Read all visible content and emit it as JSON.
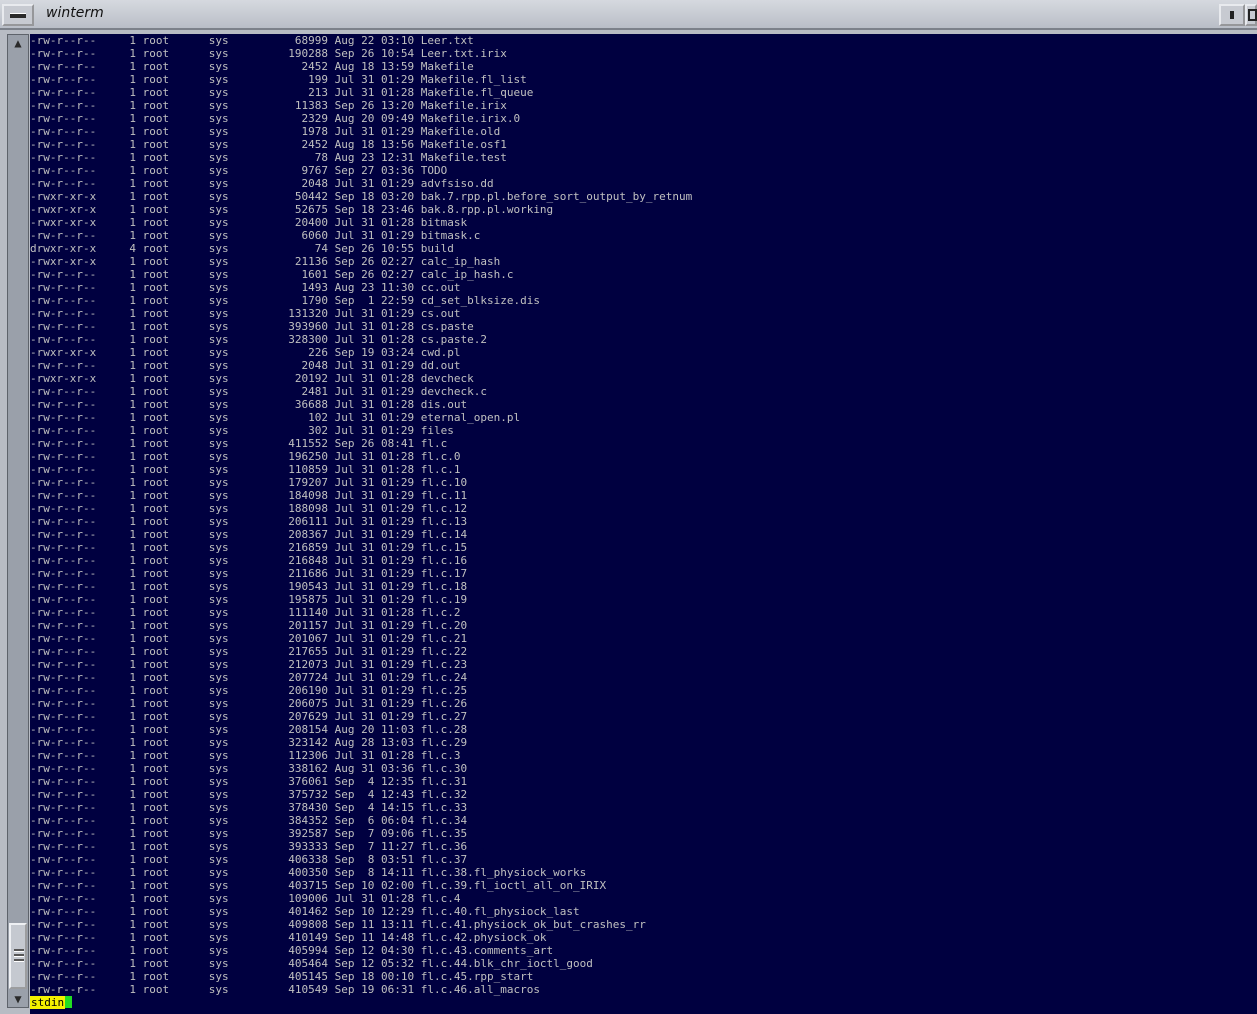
{
  "window": {
    "title": "winterm"
  },
  "prompt": {
    "label": "stdin"
  },
  "listing": [
    {
      "perm": "-rw-r--r--",
      "links": "1",
      "owner": "root",
      "group": "sys",
      "size": "68999",
      "date": "Aug 22 03:10",
      "name": "Leer.txt"
    },
    {
      "perm": "-rw-r--r--",
      "links": "1",
      "owner": "root",
      "group": "sys",
      "size": "190288",
      "date": "Sep 26 10:54",
      "name": "Leer.txt.irix"
    },
    {
      "perm": "-rw-r--r--",
      "links": "1",
      "owner": "root",
      "group": "sys",
      "size": "2452",
      "date": "Aug 18 13:59",
      "name": "Makefile"
    },
    {
      "perm": "-rw-r--r--",
      "links": "1",
      "owner": "root",
      "group": "sys",
      "size": "199",
      "date": "Jul 31 01:29",
      "name": "Makefile.fl_list"
    },
    {
      "perm": "-rw-r--r--",
      "links": "1",
      "owner": "root",
      "group": "sys",
      "size": "213",
      "date": "Jul 31 01:28",
      "name": "Makefile.fl_queue"
    },
    {
      "perm": "-rw-r--r--",
      "links": "1",
      "owner": "root",
      "group": "sys",
      "size": "11383",
      "date": "Sep 26 13:20",
      "name": "Makefile.irix"
    },
    {
      "perm": "-rw-r--r--",
      "links": "1",
      "owner": "root",
      "group": "sys",
      "size": "2329",
      "date": "Aug 20 09:49",
      "name": "Makefile.irix.0"
    },
    {
      "perm": "-rw-r--r--",
      "links": "1",
      "owner": "root",
      "group": "sys",
      "size": "1978",
      "date": "Jul 31 01:29",
      "name": "Makefile.old"
    },
    {
      "perm": "-rw-r--r--",
      "links": "1",
      "owner": "root",
      "group": "sys",
      "size": "2452",
      "date": "Aug 18 13:56",
      "name": "Makefile.osf1"
    },
    {
      "perm": "-rw-r--r--",
      "links": "1",
      "owner": "root",
      "group": "sys",
      "size": "78",
      "date": "Aug 23 12:31",
      "name": "Makefile.test"
    },
    {
      "perm": "-rw-r--r--",
      "links": "1",
      "owner": "root",
      "group": "sys",
      "size": "9767",
      "date": "Sep 27 03:36",
      "name": "TODO"
    },
    {
      "perm": "-rw-r--r--",
      "links": "1",
      "owner": "root",
      "group": "sys",
      "size": "2048",
      "date": "Jul 31 01:29",
      "name": "advfsiso.dd"
    },
    {
      "perm": "-rwxr-xr-x",
      "links": "1",
      "owner": "root",
      "group": "sys",
      "size": "50442",
      "date": "Sep 18 03:20",
      "name": "bak.7.rpp.pl.before_sort_output_by_retnum"
    },
    {
      "perm": "-rwxr-xr-x",
      "links": "1",
      "owner": "root",
      "group": "sys",
      "size": "52675",
      "date": "Sep 18 23:46",
      "name": "bak.8.rpp.pl.working"
    },
    {
      "perm": "-rwxr-xr-x",
      "links": "1",
      "owner": "root",
      "group": "sys",
      "size": "20400",
      "date": "Jul 31 01:28",
      "name": "bitmask"
    },
    {
      "perm": "-rw-r--r--",
      "links": "1",
      "owner": "root",
      "group": "sys",
      "size": "6060",
      "date": "Jul 31 01:29",
      "name": "bitmask.c"
    },
    {
      "perm": "drwxr-xr-x",
      "links": "4",
      "owner": "root",
      "group": "sys",
      "size": "74",
      "date": "Sep 26 10:55",
      "name": "build"
    },
    {
      "perm": "-rwxr-xr-x",
      "links": "1",
      "owner": "root",
      "group": "sys",
      "size": "21136",
      "date": "Sep 26 02:27",
      "name": "calc_ip_hash"
    },
    {
      "perm": "-rw-r--r--",
      "links": "1",
      "owner": "root",
      "group": "sys",
      "size": "1601",
      "date": "Sep 26 02:27",
      "name": "calc_ip_hash.c"
    },
    {
      "perm": "-rw-r--r--",
      "links": "1",
      "owner": "root",
      "group": "sys",
      "size": "1493",
      "date": "Aug 23 11:30",
      "name": "cc.out"
    },
    {
      "perm": "-rw-r--r--",
      "links": "1",
      "owner": "root",
      "group": "sys",
      "size": "1790",
      "date": "Sep  1 22:59",
      "name": "cd_set_blksize.dis"
    },
    {
      "perm": "-rw-r--r--",
      "links": "1",
      "owner": "root",
      "group": "sys",
      "size": "131320",
      "date": "Jul 31 01:29",
      "name": "cs.out"
    },
    {
      "perm": "-rw-r--r--",
      "links": "1",
      "owner": "root",
      "group": "sys",
      "size": "393960",
      "date": "Jul 31 01:28",
      "name": "cs.paste"
    },
    {
      "perm": "-rw-r--r--",
      "links": "1",
      "owner": "root",
      "group": "sys",
      "size": "328300",
      "date": "Jul 31 01:28",
      "name": "cs.paste.2"
    },
    {
      "perm": "-rwxr-xr-x",
      "links": "1",
      "owner": "root",
      "group": "sys",
      "size": "226",
      "date": "Sep 19 03:24",
      "name": "cwd.pl"
    },
    {
      "perm": "-rw-r--r--",
      "links": "1",
      "owner": "root",
      "group": "sys",
      "size": "2048",
      "date": "Jul 31 01:29",
      "name": "dd.out"
    },
    {
      "perm": "-rwxr-xr-x",
      "links": "1",
      "owner": "root",
      "group": "sys",
      "size": "20192",
      "date": "Jul 31 01:28",
      "name": "devcheck"
    },
    {
      "perm": "-rw-r--r--",
      "links": "1",
      "owner": "root",
      "group": "sys",
      "size": "2481",
      "date": "Jul 31 01:29",
      "name": "devcheck.c"
    },
    {
      "perm": "-rw-r--r--",
      "links": "1",
      "owner": "root",
      "group": "sys",
      "size": "36688",
      "date": "Jul 31 01:28",
      "name": "dis.out"
    },
    {
      "perm": "-rw-r--r--",
      "links": "1",
      "owner": "root",
      "group": "sys",
      "size": "102",
      "date": "Jul 31 01:29",
      "name": "eternal_open.pl"
    },
    {
      "perm": "-rw-r--r--",
      "links": "1",
      "owner": "root",
      "group": "sys",
      "size": "302",
      "date": "Jul 31 01:29",
      "name": "files"
    },
    {
      "perm": "-rw-r--r--",
      "links": "1",
      "owner": "root",
      "group": "sys",
      "size": "411552",
      "date": "Sep 26 08:41",
      "name": "fl.c"
    },
    {
      "perm": "-rw-r--r--",
      "links": "1",
      "owner": "root",
      "group": "sys",
      "size": "196250",
      "date": "Jul 31 01:28",
      "name": "fl.c.0"
    },
    {
      "perm": "-rw-r--r--",
      "links": "1",
      "owner": "root",
      "group": "sys",
      "size": "110859",
      "date": "Jul 31 01:28",
      "name": "fl.c.1"
    },
    {
      "perm": "-rw-r--r--",
      "links": "1",
      "owner": "root",
      "group": "sys",
      "size": "179207",
      "date": "Jul 31 01:29",
      "name": "fl.c.10"
    },
    {
      "perm": "-rw-r--r--",
      "links": "1",
      "owner": "root",
      "group": "sys",
      "size": "184098",
      "date": "Jul 31 01:29",
      "name": "fl.c.11"
    },
    {
      "perm": "-rw-r--r--",
      "links": "1",
      "owner": "root",
      "group": "sys",
      "size": "188098",
      "date": "Jul 31 01:29",
      "name": "fl.c.12"
    },
    {
      "perm": "-rw-r--r--",
      "links": "1",
      "owner": "root",
      "group": "sys",
      "size": "206111",
      "date": "Jul 31 01:29",
      "name": "fl.c.13"
    },
    {
      "perm": "-rw-r--r--",
      "links": "1",
      "owner": "root",
      "group": "sys",
      "size": "208367",
      "date": "Jul 31 01:29",
      "name": "fl.c.14"
    },
    {
      "perm": "-rw-r--r--",
      "links": "1",
      "owner": "root",
      "group": "sys",
      "size": "216859",
      "date": "Jul 31 01:29",
      "name": "fl.c.15"
    },
    {
      "perm": "-rw-r--r--",
      "links": "1",
      "owner": "root",
      "group": "sys",
      "size": "216848",
      "date": "Jul 31 01:29",
      "name": "fl.c.16"
    },
    {
      "perm": "-rw-r--r--",
      "links": "1",
      "owner": "root",
      "group": "sys",
      "size": "211686",
      "date": "Jul 31 01:29",
      "name": "fl.c.17"
    },
    {
      "perm": "-rw-r--r--",
      "links": "1",
      "owner": "root",
      "group": "sys",
      "size": "190543",
      "date": "Jul 31 01:29",
      "name": "fl.c.18"
    },
    {
      "perm": "-rw-r--r--",
      "links": "1",
      "owner": "root",
      "group": "sys",
      "size": "195875",
      "date": "Jul 31 01:29",
      "name": "fl.c.19"
    },
    {
      "perm": "-rw-r--r--",
      "links": "1",
      "owner": "root",
      "group": "sys",
      "size": "111140",
      "date": "Jul 31 01:28",
      "name": "fl.c.2"
    },
    {
      "perm": "-rw-r--r--",
      "links": "1",
      "owner": "root",
      "group": "sys",
      "size": "201157",
      "date": "Jul 31 01:29",
      "name": "fl.c.20"
    },
    {
      "perm": "-rw-r--r--",
      "links": "1",
      "owner": "root",
      "group": "sys",
      "size": "201067",
      "date": "Jul 31 01:29",
      "name": "fl.c.21"
    },
    {
      "perm": "-rw-r--r--",
      "links": "1",
      "owner": "root",
      "group": "sys",
      "size": "217655",
      "date": "Jul 31 01:29",
      "name": "fl.c.22"
    },
    {
      "perm": "-rw-r--r--",
      "links": "1",
      "owner": "root",
      "group": "sys",
      "size": "212073",
      "date": "Jul 31 01:29",
      "name": "fl.c.23"
    },
    {
      "perm": "-rw-r--r--",
      "links": "1",
      "owner": "root",
      "group": "sys",
      "size": "207724",
      "date": "Jul 31 01:29",
      "name": "fl.c.24"
    },
    {
      "perm": "-rw-r--r--",
      "links": "1",
      "owner": "root",
      "group": "sys",
      "size": "206190",
      "date": "Jul 31 01:29",
      "name": "fl.c.25"
    },
    {
      "perm": "-rw-r--r--",
      "links": "1",
      "owner": "root",
      "group": "sys",
      "size": "206075",
      "date": "Jul 31 01:29",
      "name": "fl.c.26"
    },
    {
      "perm": "-rw-r--r--",
      "links": "1",
      "owner": "root",
      "group": "sys",
      "size": "207629",
      "date": "Jul 31 01:29",
      "name": "fl.c.27"
    },
    {
      "perm": "-rw-r--r--",
      "links": "1",
      "owner": "root",
      "group": "sys",
      "size": "208154",
      "date": "Aug 20 11:03",
      "name": "fl.c.28"
    },
    {
      "perm": "-rw-r--r--",
      "links": "1",
      "owner": "root",
      "group": "sys",
      "size": "323142",
      "date": "Aug 28 13:03",
      "name": "fl.c.29"
    },
    {
      "perm": "-rw-r--r--",
      "links": "1",
      "owner": "root",
      "group": "sys",
      "size": "112306",
      "date": "Jul 31 01:28",
      "name": "fl.c.3"
    },
    {
      "perm": "-rw-r--r--",
      "links": "1",
      "owner": "root",
      "group": "sys",
      "size": "338162",
      "date": "Aug 31 03:36",
      "name": "fl.c.30"
    },
    {
      "perm": "-rw-r--r--",
      "links": "1",
      "owner": "root",
      "group": "sys",
      "size": "376061",
      "date": "Sep  4 12:35",
      "name": "fl.c.31"
    },
    {
      "perm": "-rw-r--r--",
      "links": "1",
      "owner": "root",
      "group": "sys",
      "size": "375732",
      "date": "Sep  4 12:43",
      "name": "fl.c.32"
    },
    {
      "perm": "-rw-r--r--",
      "links": "1",
      "owner": "root",
      "group": "sys",
      "size": "378430",
      "date": "Sep  4 14:15",
      "name": "fl.c.33"
    },
    {
      "perm": "-rw-r--r--",
      "links": "1",
      "owner": "root",
      "group": "sys",
      "size": "384352",
      "date": "Sep  6 06:04",
      "name": "fl.c.34"
    },
    {
      "perm": "-rw-r--r--",
      "links": "1",
      "owner": "root",
      "group": "sys",
      "size": "392587",
      "date": "Sep  7 09:06",
      "name": "fl.c.35"
    },
    {
      "perm": "-rw-r--r--",
      "links": "1",
      "owner": "root",
      "group": "sys",
      "size": "393333",
      "date": "Sep  7 11:27",
      "name": "fl.c.36"
    },
    {
      "perm": "-rw-r--r--",
      "links": "1",
      "owner": "root",
      "group": "sys",
      "size": "406338",
      "date": "Sep  8 03:51",
      "name": "fl.c.37"
    },
    {
      "perm": "-rw-r--r--",
      "links": "1",
      "owner": "root",
      "group": "sys",
      "size": "400350",
      "date": "Sep  8 14:11",
      "name": "fl.c.38.fl_physiock_works"
    },
    {
      "perm": "-rw-r--r--",
      "links": "1",
      "owner": "root",
      "group": "sys",
      "size": "403715",
      "date": "Sep 10 02:00",
      "name": "fl.c.39.fl_ioctl_all_on_IRIX"
    },
    {
      "perm": "-rw-r--r--",
      "links": "1",
      "owner": "root",
      "group": "sys",
      "size": "109006",
      "date": "Jul 31 01:28",
      "name": "fl.c.4"
    },
    {
      "perm": "-rw-r--r--",
      "links": "1",
      "owner": "root",
      "group": "sys",
      "size": "401462",
      "date": "Sep 10 12:29",
      "name": "fl.c.40.fl_physiock_last"
    },
    {
      "perm": "-rw-r--r--",
      "links": "1",
      "owner": "root",
      "group": "sys",
      "size": "409808",
      "date": "Sep 11 13:11",
      "name": "fl.c.41.physiock_ok_but_crashes_rr"
    },
    {
      "perm": "-rw-r--r--",
      "links": "1",
      "owner": "root",
      "group": "sys",
      "size": "410149",
      "date": "Sep 11 14:48",
      "name": "fl.c.42.physiock_ok"
    },
    {
      "perm": "-rw-r--r--",
      "links": "1",
      "owner": "root",
      "group": "sys",
      "size": "405994",
      "date": "Sep 12 04:30",
      "name": "fl.c.43.comments_art"
    },
    {
      "perm": "-rw-r--r--",
      "links": "1",
      "owner": "root",
      "group": "sys",
      "size": "405464",
      "date": "Sep 12 05:32",
      "name": "fl.c.44.blk_chr_ioctl_good"
    },
    {
      "perm": "-rw-r--r--",
      "links": "1",
      "owner": "root",
      "group": "sys",
      "size": "405145",
      "date": "Sep 18 00:10",
      "name": "fl.c.45.rpp_start"
    },
    {
      "perm": "-rw-r--r--",
      "links": "1",
      "owner": "root",
      "group": "sys",
      "size": "410549",
      "date": "Sep 19 06:31",
      "name": "fl.c.46.all_macros"
    }
  ]
}
